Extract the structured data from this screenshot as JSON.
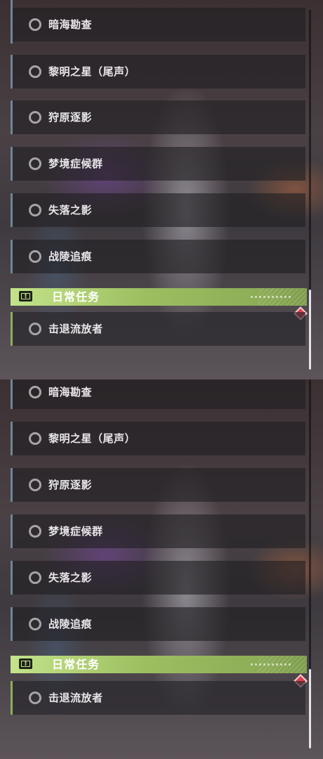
{
  "top_panel": {
    "quests": [
      {
        "label": "暗海勘查"
      },
      {
        "label": "黎明之星（尾声）"
      },
      {
        "label": "狩原逐影"
      },
      {
        "label": "梦境症候群"
      },
      {
        "label": "失落之影"
      },
      {
        "label": "战陵追痕"
      }
    ],
    "daily_header": {
      "title": "日常任务",
      "icon": "alert-icon"
    },
    "daily_quests": [
      {
        "label": "击退流放者"
      }
    ],
    "marker_icon": "diamond-marker-icon"
  },
  "bottom_panel": {
    "quests": [
      {
        "label": "暗海勘查"
      },
      {
        "label": "黎明之星（尾声）"
      },
      {
        "label": "狩原逐影"
      },
      {
        "label": "梦境症候群"
      },
      {
        "label": "失落之影"
      },
      {
        "label": "战陵追痕"
      }
    ],
    "daily_header": {
      "title": "日常任务",
      "icon": "alert-icon"
    },
    "daily_quests": [
      {
        "label": "击退流放者"
      }
    ],
    "marker_icon": "diamond-marker-icon"
  },
  "colors": {
    "daily_header_green": "#b2d474",
    "row_accent_blue": "#6f8696",
    "row_accent_green": "#8fae5a",
    "marker_red": "#d9434e"
  }
}
